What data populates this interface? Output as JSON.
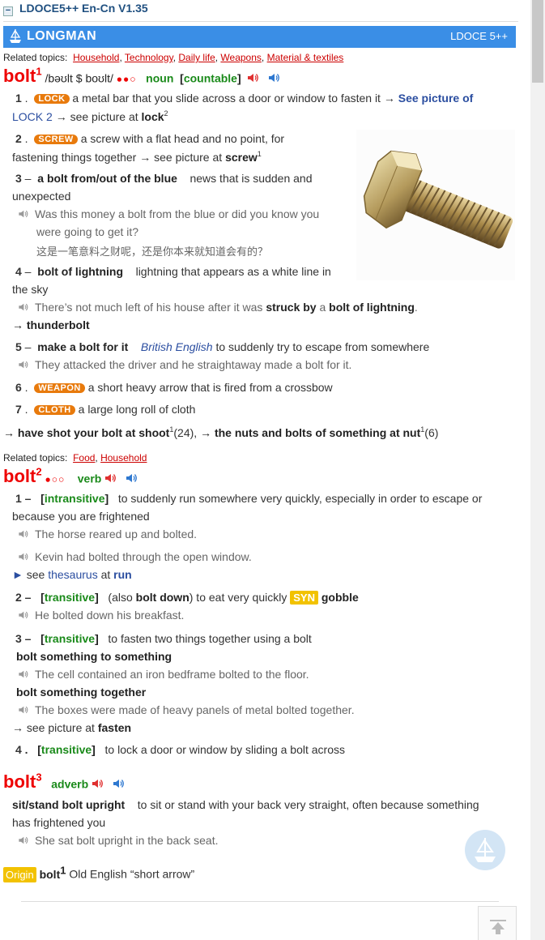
{
  "dict_title": "LDOCE5++ En-Cn V1.35",
  "banner": {
    "brand": "LONGMAN",
    "version": "LDOCE 5++"
  },
  "entry1": {
    "topics_label": "Related topics:",
    "topics": [
      "Household",
      "Technology",
      "Daily life",
      "Weapons",
      "Material & textiles"
    ],
    "hw": "bolt",
    "hom": "1",
    "pron": "/bəʊlt $ boʊlt/",
    "freq": "●●○",
    "pos": "noun",
    "gram": "countable",
    "senses": {
      "s1": {
        "num": "1",
        "signpost": "LOCK",
        "def": "a metal bar that you slide across a door or window to fasten it →",
        "see": "See picture of",
        "see2": "LOCK 2",
        "tail": "→ see picture at",
        "tailword": "lock",
        "sup": "2"
      },
      "s2": {
        "num": "2",
        "signpost": "SCREW",
        "def1": "a screw with a flat head and no point, for",
        "def2": "fastening things together → see picture at",
        "tailword": "screw",
        "sup": "1"
      },
      "s3": {
        "num": "3",
        "phrase": "a bolt from/out of the blue",
        "def1": "news that is sudden and",
        "def2": "unexpected",
        "ex1": "Was this money a bolt from the blue or did you know you",
        "ex2": "were going to get it?",
        "zh": "这是一笔意料之财呢，还是你本来就知道会有的？"
      },
      "s4": {
        "num": "4",
        "phrase": "bolt of lightning",
        "def1": "lightning that appears as a white line in",
        "def2": "the sky",
        "ex": "There’s not much left of his house after it was",
        "exb1": "struck by",
        "exmid": "a",
        "exb2": "bolt of lightning",
        "exend": ".",
        "xref": "→ thunderbolt"
      },
      "s5": {
        "num": "5",
        "phrase": "make a bolt for it",
        "region": "British English",
        "def": "to suddenly try to escape from somewhere",
        "ex": "They attacked the driver and he straightaway made a bolt for it."
      },
      "s6": {
        "num": "6",
        "signpost": "WEAPON",
        "def": "a short heavy arrow that is fired from a crossbow"
      },
      "s7": {
        "num": "7",
        "signpost": "CLOTH",
        "def": "a large long roll of cloth"
      }
    },
    "xrefs": {
      "a": "→ have shot your bolt at shoot",
      "a_sup": "1",
      "a_n": "(24), ",
      "b": "→ the nuts and bolts of something at nut",
      "b_sup": "1",
      "b_n": "(6)"
    }
  },
  "entry2": {
    "topics_label": "Related topics:",
    "topics": [
      "Food",
      "Household"
    ],
    "hw": "bolt",
    "hom": "2",
    "freq": "●○○",
    "pos": "verb",
    "senses": {
      "s1": {
        "num": "1 –",
        "gram": "intransitive",
        "def1": "to suddenly run somewhere very quickly, especially in order to escape or",
        "def2": "because you are frightened",
        "ex1": "The horse reared up and bolted.",
        "ex2": "Kevin had bolted through the open window.",
        "thes1": "see",
        "thes2": "thesaurus",
        "thes3": "at",
        "thes4": "run"
      },
      "s2": {
        "num": "2 –",
        "gram": "transitive",
        "also": "(also",
        "alsob": "bolt down",
        "def": ") to eat very quickly",
        "syn": "SYN",
        "synword": "gobble",
        "ex": "He bolted down his breakfast."
      },
      "s3": {
        "num": "3 –",
        "gram": "transitive",
        "def": "to fasten two things together using a bolt",
        "p1": "bolt something to something",
        "ex1": "The cell contained an iron bedframe bolted to the floor.",
        "p2": "bolt something together",
        "ex2": "The boxes were made of heavy panels of metal bolted together.",
        "see": "→ see picture at",
        "seew": "fasten"
      },
      "s4": {
        "num": "4 .",
        "gram": "transitive",
        "def": "to lock a door or window by sliding a bolt across"
      }
    }
  },
  "entry3": {
    "hw": "bolt",
    "hom": "3",
    "pos": "adverb",
    "phrase": "sit/stand bolt upright",
    "def1": "to sit or stand with your back very straight, often because something",
    "def2": "has frightened you",
    "ex": "She sat bolt upright in the back seat."
  },
  "origin": {
    "label": "Origin",
    "word": "bolt",
    "sup": "1",
    "text": "Old English “short arrow”"
  },
  "icons": {
    "speaker_uk": "speaker-red-icon",
    "speaker_us": "speaker-blue-icon",
    "example": "example-speaker-icon",
    "top": "back-to-top-icon"
  },
  "colors": {
    "headword": "#e00000",
    "pos": "#1a8a1a",
    "signpost": "#e87a0c",
    "banner": "#3a8ee6",
    "syn": "#f2c200"
  }
}
